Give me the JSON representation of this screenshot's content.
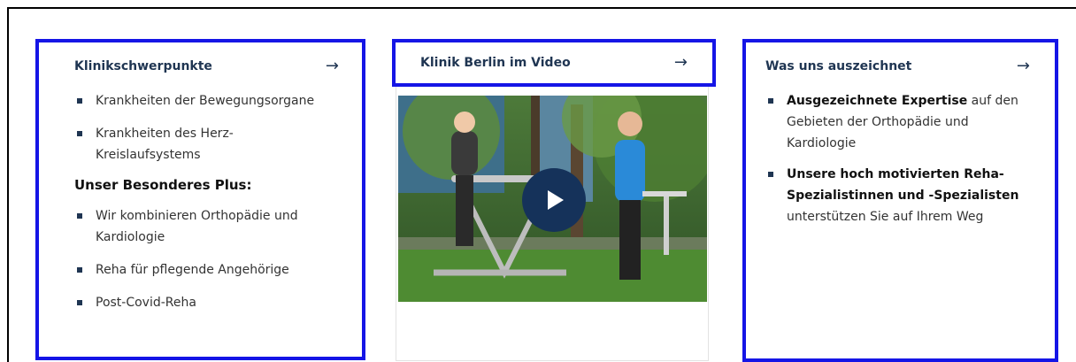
{
  "card_left": {
    "title": "Klinikschwerpunkte",
    "items": [
      "Krankheiten der Bewegungsorgane",
      "Krankheiten des Herz-Kreislaufsystems"
    ],
    "subheading": "Unser Besonderes Plus:",
    "plus_items": [
      "Wir kombinieren Orthopädie und Kardiologie",
      "Reha für pflegende Angehörige",
      "Post-Covid-Reha"
    ]
  },
  "card_middle": {
    "title": "Klinik Berlin im Video"
  },
  "card_right": {
    "title": "Was uns auszeichnet",
    "items": [
      {
        "bold": "Ausgezeichnete Expertise",
        "rest": " auf den Gebieten der Orthopädie und Kardiologie"
      },
      {
        "bold": "Unsere hoch motivierten Reha-Spezialistinnen und -Spezialisten",
        "rest": " unterstützen Sie auf Ihrem Weg"
      }
    ]
  },
  "icons": {
    "arrow": "arrow-right-icon",
    "play": "play-icon"
  },
  "colors": {
    "highlight": "#1515e6",
    "navy": "#1f3552",
    "play_bg": "#15325a"
  }
}
